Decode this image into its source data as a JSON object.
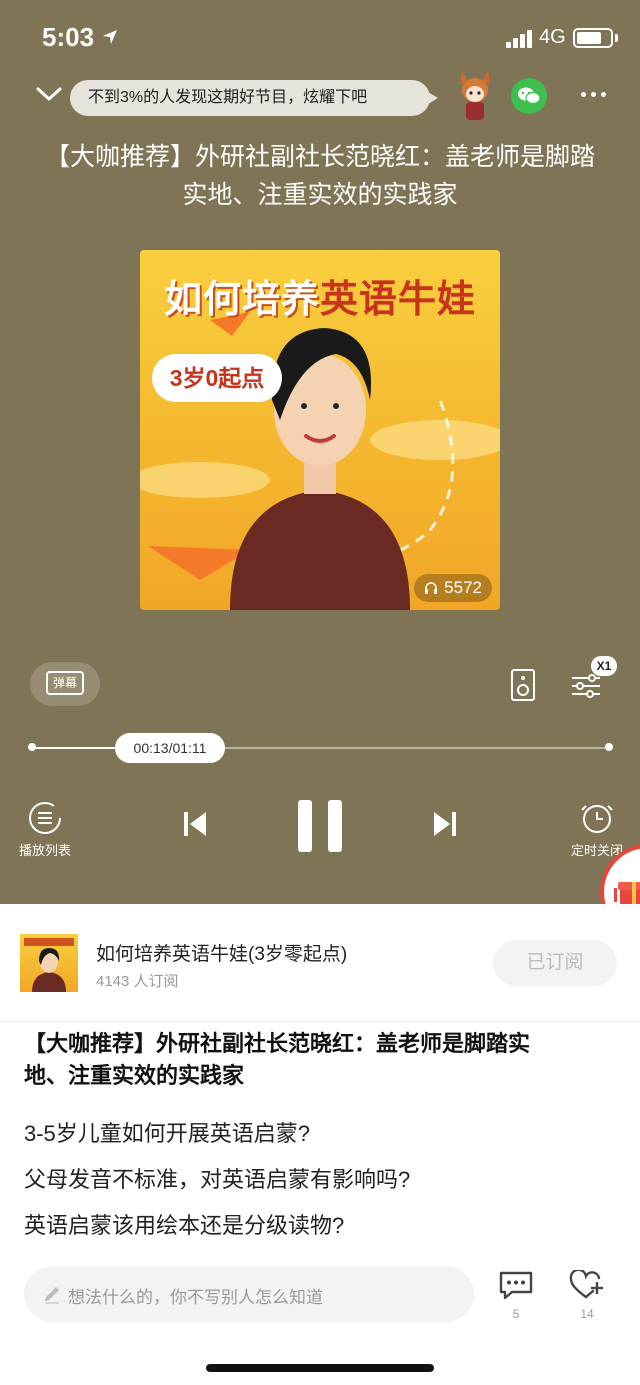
{
  "status_bar": {
    "time": "5:03",
    "network": "4G"
  },
  "header": {
    "promo_text": "不到3%的人发现这期好节目，炫耀下吧",
    "episode_title": "【大咖推荐】外研社副社长范晓红：盖老师是脚踏实地、注重实效的实践家"
  },
  "cover": {
    "title_part1": "如何培养",
    "title_part2": "英语牛娃",
    "badge": "3岁0起点",
    "play_count": "5572"
  },
  "controls": {
    "danmu_label": "弹幕",
    "speed": "X1",
    "progress_time": "00:13/01:11",
    "progress_fraction": 0.18,
    "playlist_label": "播放列表",
    "timer_label": "定时关闭"
  },
  "album": {
    "name": "如何培养英语牛娃(3岁零起点)",
    "subscribers": "4143 人订阅",
    "subscribe_button": "已订阅"
  },
  "details": {
    "title": "【大咖推荐】外研社副社长范晓红：盖老师是脚踏实地、注重实效的实践家",
    "lines": [
      "3-5岁儿童如何开展英语启蒙?",
      "父母发音不标准，对英语启蒙有影响吗?",
      "英语启蒙该用绘本还是分级读物?"
    ]
  },
  "footer": {
    "comment_placeholder": "想法什么的，你不写别人怎么知道",
    "comment_count": "5",
    "like_count": "14"
  },
  "colors": {
    "player_bg": "#7f7456",
    "accent_red": "#c7341b",
    "wechat_green": "#3fbf4f"
  }
}
